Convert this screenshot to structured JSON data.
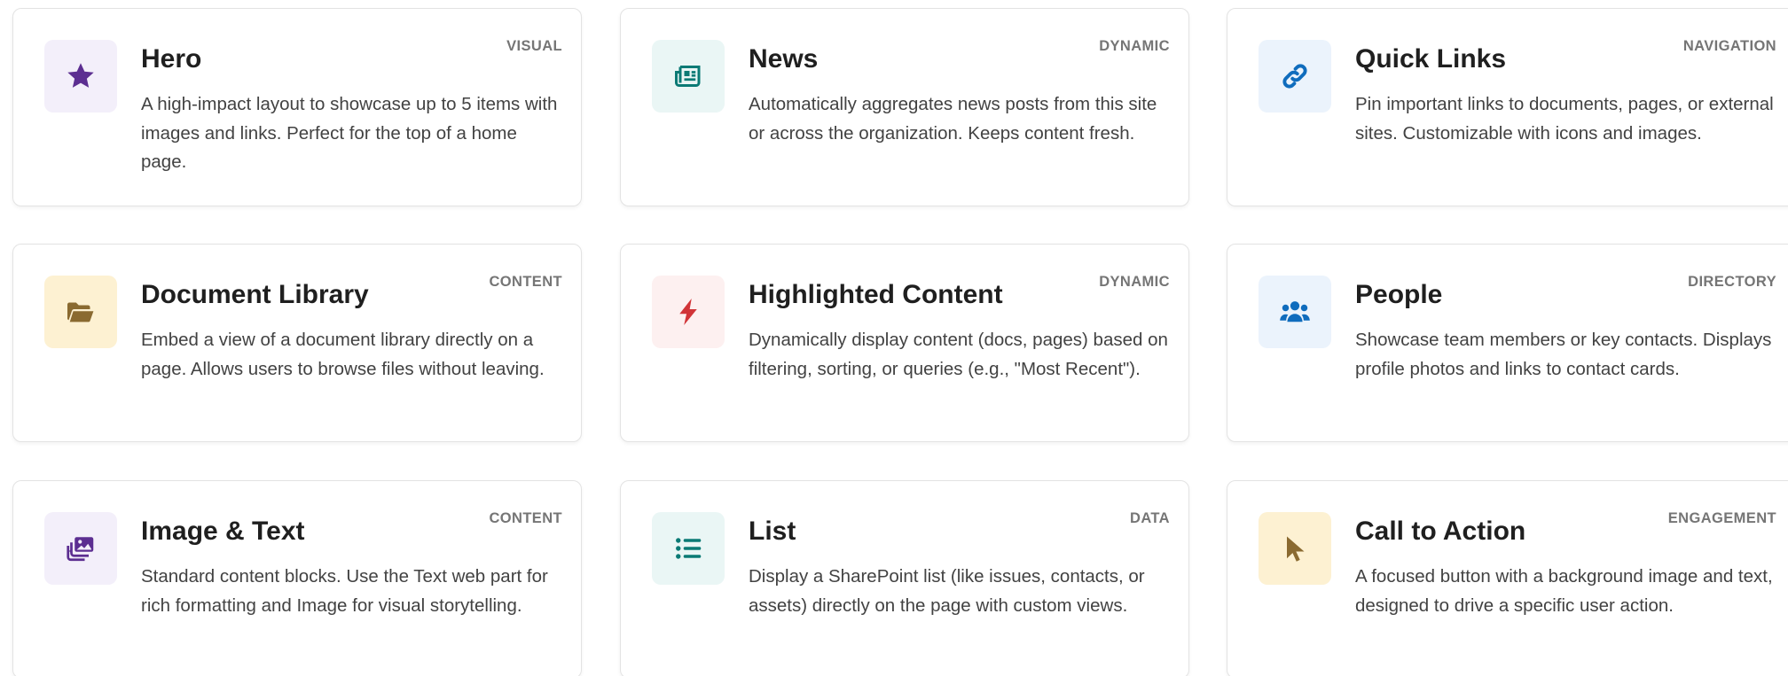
{
  "cards": [
    {
      "title": "Hero",
      "badge": "VISUAL",
      "description": "A high-impact layout to showcase up to 5 items with images and links. Perfect for the top of a home page.",
      "icon": "star-icon",
      "icon_color": "#5c2e91",
      "tile_color": "#f3effa"
    },
    {
      "title": "News",
      "badge": "DYNAMIC",
      "description": "Automatically aggregates news posts from this site or across the organization. Keeps content fresh.",
      "icon": "newspaper-icon",
      "icon_color": "#0b7a75",
      "tile_color": "#eaf6f5"
    },
    {
      "title": "Quick Links",
      "badge": "NAVIGATION",
      "description": "Pin important links to documents, pages, or external sites. Customizable with icons and images.",
      "icon": "link-icon",
      "icon_color": "#0f6cbd",
      "tile_color": "#ebf3fc"
    },
    {
      "title": "Document Library",
      "badge": "CONTENT",
      "description": "Embed a view of a document library directly on a page. Allows users to browse files without leaving.",
      "icon": "folder-open-icon",
      "icon_color": "#8a6a30",
      "tile_color": "#fdf1d2"
    },
    {
      "title": "Highlighted Content",
      "badge": "DYNAMIC",
      "description": "Dynamically display content (docs, pages) based on filtering, sorting, or queries (e.g., \"Most Recent\").",
      "icon": "lightning-bolt-icon",
      "icon_color": "#d13438",
      "tile_color": "#fdf0f0"
    },
    {
      "title": "People",
      "badge": "DIRECTORY",
      "description": "Showcase team members or key contacts. Displays profile photos and links to contact cards.",
      "icon": "people-icon",
      "icon_color": "#0f6cbd",
      "tile_color": "#ebf3fc"
    },
    {
      "title": "Image & Text",
      "badge": "CONTENT",
      "description": "Standard content blocks. Use the Text web part for rich formatting and Image for visual storytelling.",
      "icon": "photo-gallery-icon",
      "icon_color": "#5c2e91",
      "tile_color": "#f3effa"
    },
    {
      "title": "List",
      "badge": "DATA",
      "description": "Display a SharePoint list (like issues, contacts, or assets) directly on the page with custom views.",
      "icon": "list-icon",
      "icon_color": "#0b7a75",
      "tile_color": "#eaf6f5"
    },
    {
      "title": "Call to Action",
      "badge": "ENGAGEMENT",
      "description": "A focused button with a background image and text, designed to drive a specific user action.",
      "icon": "cursor-pointer-icon",
      "icon_color": "#8a6a30",
      "tile_color": "#fdf1d2"
    }
  ]
}
